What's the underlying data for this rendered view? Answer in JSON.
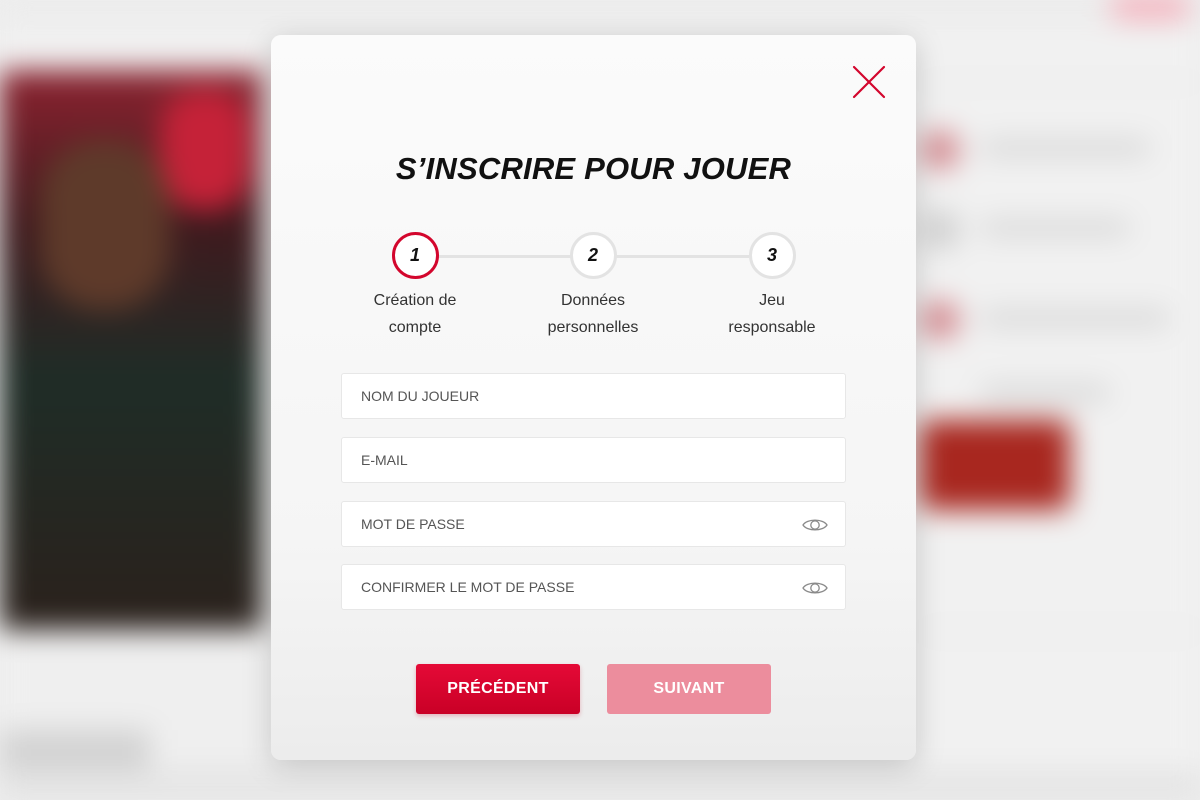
{
  "modal": {
    "title": "S’INSCRIRE POUR JOUER"
  },
  "stepper": {
    "active_step": 1,
    "steps": [
      {
        "number": "1",
        "label_line1": "Création de",
        "label_line2": "compte"
      },
      {
        "number": "2",
        "label_line1": "Données",
        "label_line2": "personnelles"
      },
      {
        "number": "3",
        "label_line1": "Jeu",
        "label_line2": "responsable"
      }
    ]
  },
  "form": {
    "player_name": {
      "placeholder": "NOM DU JOUEUR",
      "value": ""
    },
    "email": {
      "placeholder": "E-MAIL",
      "value": ""
    },
    "password": {
      "placeholder": "MOT DE PASSE",
      "value": "",
      "icon": "eye-icon"
    },
    "confirm_password": {
      "placeholder": "CONFIRMER LE MOT DE PASSE",
      "value": "",
      "icon": "eye-icon"
    }
  },
  "buttons": {
    "previous_label": "PRÉCÉDENT",
    "next_label": "SUIVANT"
  },
  "colors": {
    "accent": "#d3062d",
    "button_primary": "#e50a37",
    "button_disabled": "#ec8d9d",
    "close_icon": "#d3062d"
  }
}
